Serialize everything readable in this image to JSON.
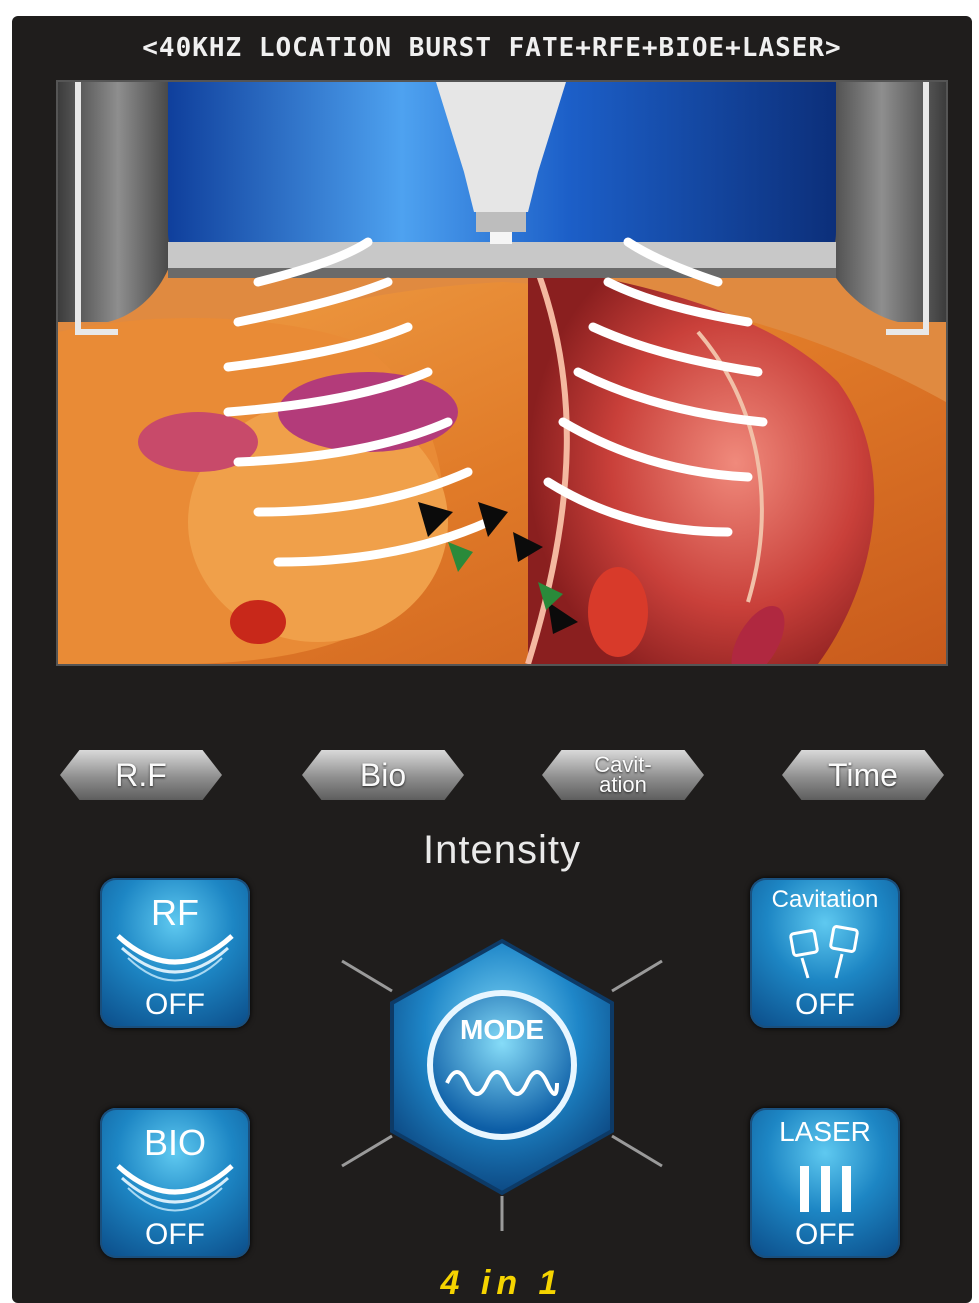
{
  "header": {
    "title": "<40KHZ LOCATION BURST FATE+RFE+BIOE+LASER>"
  },
  "tabs": [
    {
      "label": "R.F"
    },
    {
      "label": "Bio"
    },
    {
      "label_line1": "Cavit-",
      "label_line2": "ation"
    },
    {
      "label": "Time"
    }
  ],
  "intensity_label": "Intensity",
  "mode_buttons": {
    "rf": {
      "title": "RF",
      "status": "OFF"
    },
    "bio": {
      "title": "BIO",
      "status": "OFF"
    },
    "cavitation": {
      "title": "Cavitation",
      "status": "OFF"
    },
    "laser": {
      "title": "LASER",
      "status": "OFF"
    }
  },
  "mode_center": {
    "label": "MODE"
  },
  "footer": {
    "text": "4 in 1"
  },
  "colors": {
    "panel": "#1f1d1c",
    "button_blue": "#1d86c4",
    "footer_yellow": "#f5d400",
    "tab_gray": "#8e8e8e"
  },
  "icons": [
    "curve-smile-icon",
    "wave-icon",
    "transducer-icon",
    "laser-bars-icon"
  ]
}
